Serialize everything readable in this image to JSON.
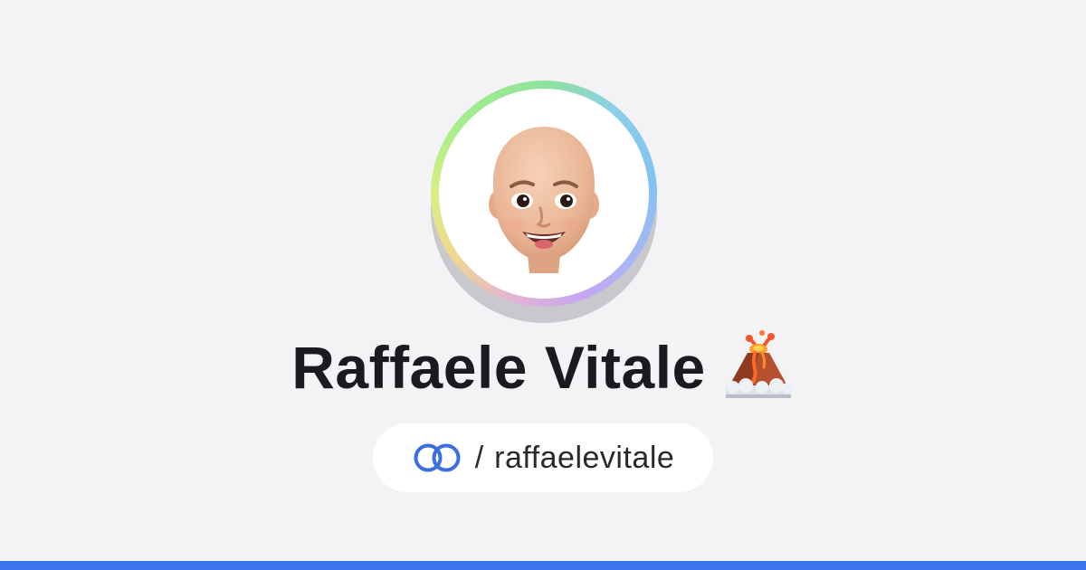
{
  "profile": {
    "name": "Raffaele Vitale",
    "name_emoji_icon": "volcano-icon",
    "avatar_icon": "memoji-avatar-icon",
    "handle_separator": "/",
    "handle": "raffaelevitale",
    "handle_icon": "interlocking-rings-icon"
  },
  "colors": {
    "background": "#f3f3f5",
    "accent_bar": "#3b74ee",
    "rings_icon": "#3b6fe0",
    "name_text": "#1b1b1f"
  }
}
